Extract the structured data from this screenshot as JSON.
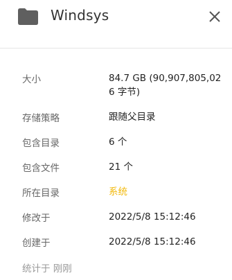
{
  "header": {
    "title": "Windsys",
    "icon": "folder-icon",
    "close_icon": "close-icon"
  },
  "details": [
    {
      "label": "大小",
      "value": "84.7 GB (90,907,805,02\n6 字节)"
    },
    {
      "label": "存储策略",
      "value": "跟随父目录"
    },
    {
      "label": "包含目录",
      "value": "6 个"
    },
    {
      "label": "包含文件",
      "value": "21 个"
    },
    {
      "label": "所在目录",
      "value": "系统"
    },
    {
      "label": "修改于",
      "value": "2022/5/8 15:12:46"
    },
    {
      "label": "创建于",
      "value": "2022/5/8 15:12:46"
    }
  ],
  "footer": {
    "text": "统计于 刚刚"
  },
  "colors": {
    "link": "#f2b90c",
    "icon": "#5f5f5f"
  }
}
